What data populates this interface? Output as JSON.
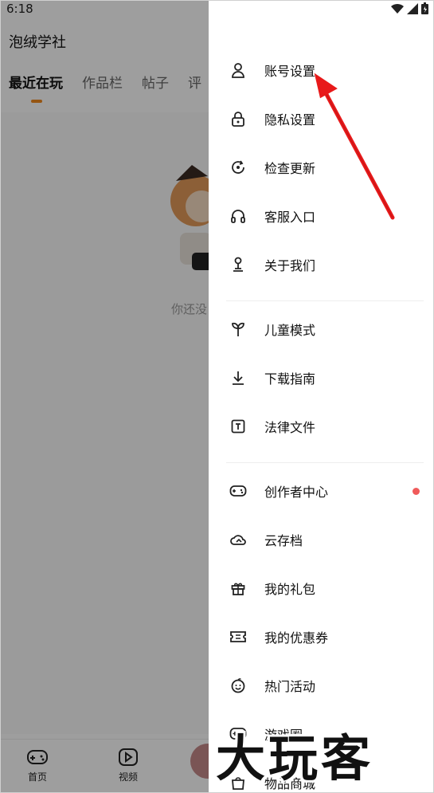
{
  "status": {
    "time": "6:18"
  },
  "app": {
    "title": "泡绒学社",
    "tabs": [
      "最近在玩",
      "作品栏",
      "帖子",
      "评"
    ],
    "empty_text": "你还没",
    "bottom_nav": [
      "首页",
      "视频"
    ]
  },
  "drawer": {
    "groups": [
      [
        {
          "label": "账号设置",
          "icon": "user-icon"
        },
        {
          "label": "隐私设置",
          "icon": "lock-icon"
        },
        {
          "label": "检查更新",
          "icon": "refresh-icon"
        },
        {
          "label": "客服入口",
          "icon": "headset-icon"
        },
        {
          "label": "关于我们",
          "icon": "person-stand-icon"
        }
      ],
      [
        {
          "label": "儿童模式",
          "icon": "sprout-icon"
        },
        {
          "label": "下载指南",
          "icon": "download-icon"
        },
        {
          "label": "法律文件",
          "icon": "text-doc-icon"
        }
      ],
      [
        {
          "label": "创作者中心",
          "icon": "gamepad-icon",
          "badge": true
        },
        {
          "label": "云存档",
          "icon": "cloud-icon"
        },
        {
          "label": "我的礼包",
          "icon": "gift-icon"
        },
        {
          "label": "我的优惠券",
          "icon": "ticket-icon"
        },
        {
          "label": "热门活动",
          "icon": "smile-icon"
        },
        {
          "label": "游戏圈",
          "icon": "chat-game-icon"
        },
        {
          "label": "物品商城",
          "icon": "shop-icon"
        }
      ]
    ]
  },
  "watermark": "大玩客",
  "colors": {
    "accent": "#f08a1e",
    "badge": "#f05a5a",
    "arrow": "#e8191a"
  }
}
